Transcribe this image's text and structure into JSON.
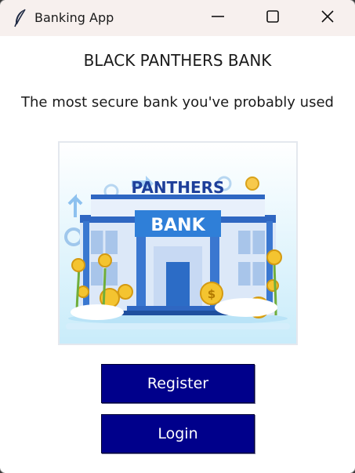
{
  "window": {
    "title": "Banking App",
    "icon": "feather-icon"
  },
  "window_controls": {
    "minimize_icon": "minimize-icon",
    "maximize_icon": "maximize-icon",
    "close_icon": "close-icon"
  },
  "main": {
    "heading": "BLACK PANTHERS BANK",
    "tagline": "The most secure bank you've probably used",
    "illustration": {
      "icon": "bank-building-illustration",
      "sign_top": "PANTHERS",
      "sign_bottom": "BANK"
    },
    "buttons": {
      "register_label": "Register",
      "login_label": "Login"
    }
  },
  "colors": {
    "titlebar_bg": "#f7f0ee",
    "button_bg": "#00008b",
    "button_text": "#ffffff",
    "text": "#1a1a1a",
    "sky": "#cfeefb",
    "building": "#3f7fd4",
    "coin": "#f4c430"
  }
}
